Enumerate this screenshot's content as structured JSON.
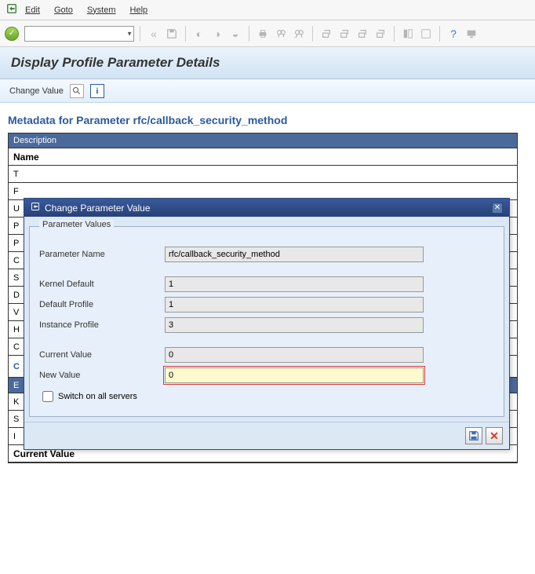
{
  "menu": {
    "edit": "Edit",
    "goto": "Goto",
    "system": "System",
    "help": "Help"
  },
  "page_title": "Display Profile Parameter Details",
  "subtoolbar": {
    "change_value_label": "Change Value"
  },
  "metadata": {
    "heading": "Metadata for Parameter rfc/callback_security_method",
    "description_label": "Description",
    "name_label": "Name",
    "rows_truncated": [
      "T",
      "F",
      "U",
      "P",
      "P",
      "C",
      "S",
      "D",
      "V",
      "H",
      "C"
    ],
    "section2_prefix": "C",
    "e_label": "E",
    "k_label": "K",
    "s_label": "S",
    "instance_profile_label": "Instance Profile",
    "current_value_label": "Current Value"
  },
  "dialog": {
    "title": "Change Parameter Value",
    "group_title": "Parameter Values",
    "param_name_label": "Parameter Name",
    "param_name_value": "rfc/callback_security_method",
    "kernel_default_label": "Kernel Default",
    "kernel_default_value": "1",
    "default_profile_label": "Default Profile",
    "default_profile_value": "1",
    "instance_profile_label": "Instance Profile",
    "instance_profile_value": "3",
    "current_value_label": "Current Value",
    "current_value_value": "0",
    "new_value_label": "New Value",
    "new_value_value": "0",
    "switch_all_label": "Switch on all servers"
  }
}
